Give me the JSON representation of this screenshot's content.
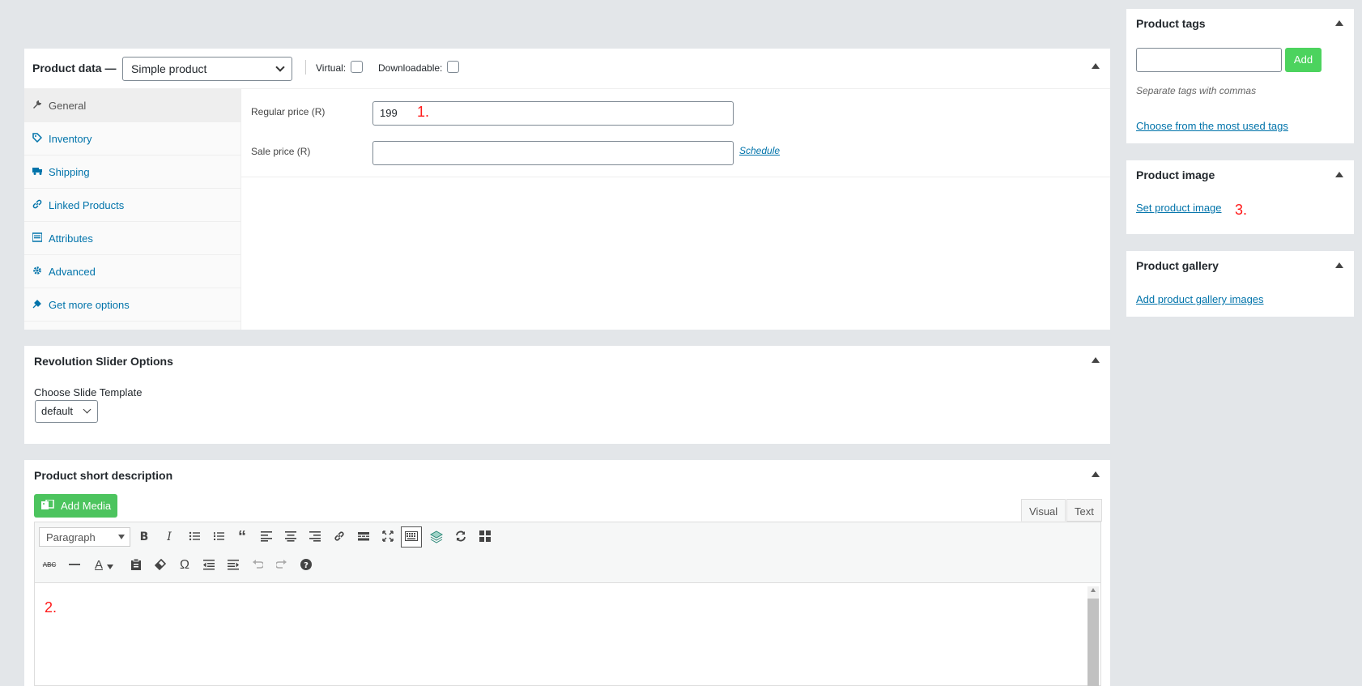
{
  "product_data": {
    "title": "Product data —",
    "type_select": "Simple product",
    "virtual_label": "Virtual:",
    "downloadable_label": "Downloadable:",
    "tabs": [
      {
        "label": "General",
        "icon": "wrench-icon",
        "active": true
      },
      {
        "label": "Inventory",
        "icon": "tag-icon"
      },
      {
        "label": "Shipping",
        "icon": "truck-icon"
      },
      {
        "label": "Linked Products",
        "icon": "link-icon"
      },
      {
        "label": "Attributes",
        "icon": "list-icon"
      },
      {
        "label": "Advanced",
        "icon": "gear-icon"
      },
      {
        "label": "Get more options",
        "icon": "plugin-icon"
      }
    ],
    "regular_price_label": "Regular price (R)",
    "regular_price_value": "199",
    "sale_price_label": "Sale price (R)",
    "sale_price_value": "",
    "schedule_link": "Schedule"
  },
  "annotations": {
    "note1": "1.",
    "note2": "2.",
    "note3": "3."
  },
  "rev_slider": {
    "title": "Revolution Slider Options",
    "template_label": "Choose Slide Template",
    "template_value": "default"
  },
  "short_description": {
    "title": "Product short description",
    "add_media": "Add Media",
    "tab_visual": "Visual",
    "tab_text": "Text",
    "format_select": "Paragraph"
  },
  "sidebar": {
    "tags": {
      "title": "Product tags",
      "add_button": "Add",
      "hint": "Separate tags with commas",
      "most_used_link": "Choose from the most used tags"
    },
    "image": {
      "title": "Product image",
      "set_link": "Set product image"
    },
    "gallery": {
      "title": "Product gallery",
      "add_link": "Add product gallery images"
    }
  },
  "colors": {
    "link": "#0073aa",
    "green_button": "#4cd35e",
    "annotation_red": "#ff1a1a",
    "background": "#e3e6e9"
  }
}
